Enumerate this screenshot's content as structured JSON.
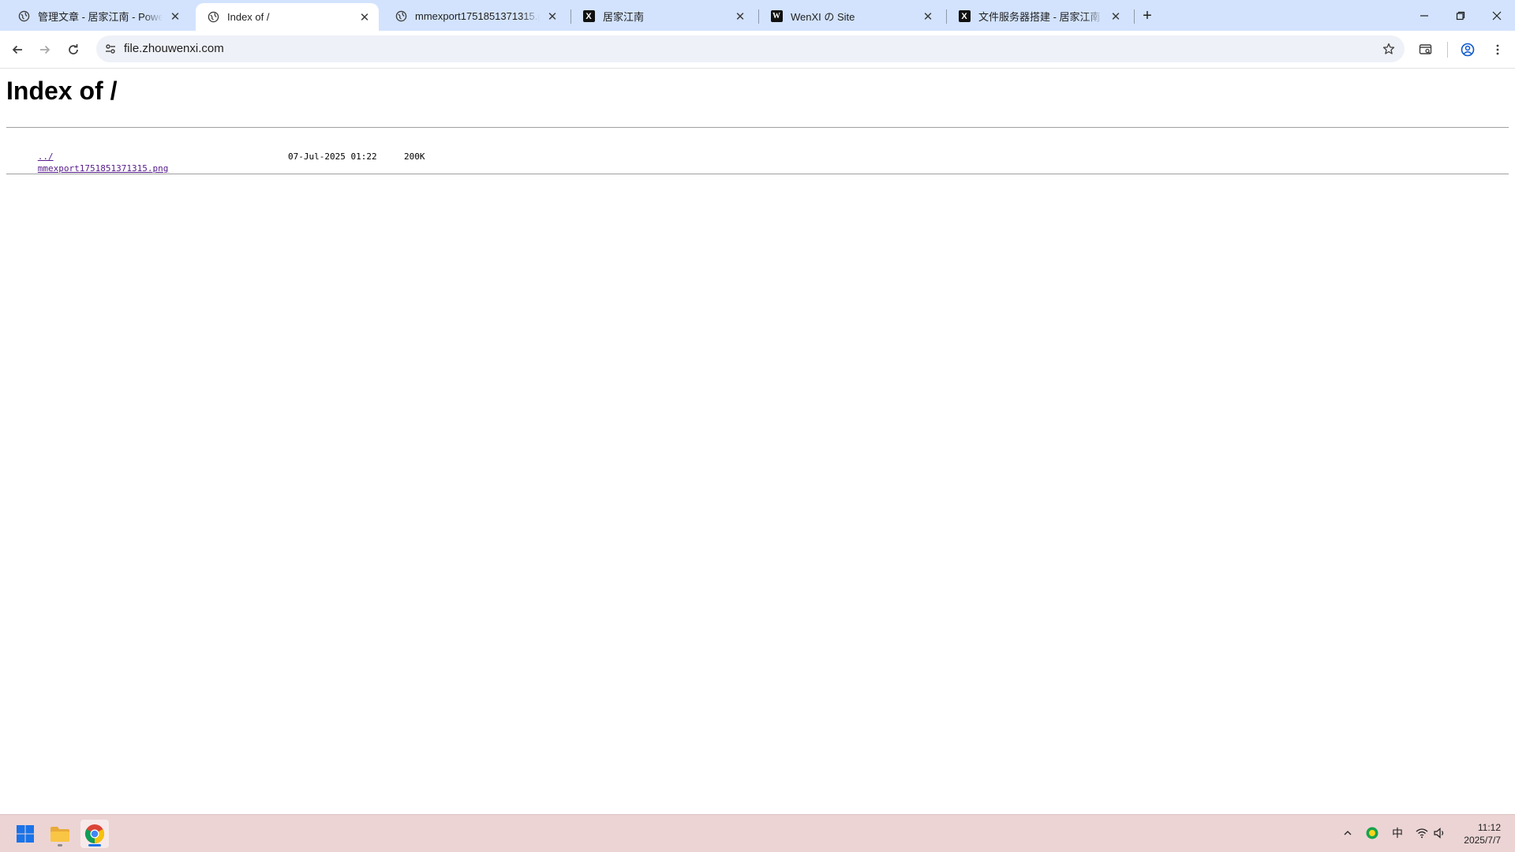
{
  "browser": {
    "tabs": [
      {
        "title": "管理文章 - 居家江南 - Powere",
        "icon": "globe-icon",
        "active": false
      },
      {
        "title": "Index of /",
        "icon": "globe-icon",
        "active": true
      },
      {
        "title": "mmexport1751851371315.pn",
        "icon": "globe-icon",
        "active": false
      },
      {
        "title": "居家江南",
        "icon": "x-logo-icon",
        "icon_text": "X",
        "active": false
      },
      {
        "title": "WenXI の Site",
        "icon": "w-logo-icon",
        "icon_text": "W",
        "active": false
      },
      {
        "title": "文件服务器搭建 - 居家江南",
        "icon": "x-logo-icon",
        "icon_text": "X",
        "active": false
      }
    ],
    "new_tab_label": "+",
    "address": "file.zhouwenxi.com"
  },
  "page": {
    "heading": "Index of /",
    "entries": [
      {
        "name": "../",
        "date": "",
        "size": ""
      },
      {
        "name": "mmexport1751851371315.png",
        "date": "07-Jul-2025 01:22",
        "size": "200K"
      }
    ]
  },
  "taskbar": {
    "apps": [
      "start-icon",
      "file-explorer-icon",
      "chrome-icon"
    ],
    "tray": {
      "ime": "中",
      "time": "11:12",
      "date": "2025/7/7"
    }
  },
  "colors": {
    "tabstrip_bg": "#d3e3fd",
    "omnibox_bg": "#eef1f7",
    "taskbar_bg": "#ecd4d4",
    "visited_link": "#551a8b"
  }
}
